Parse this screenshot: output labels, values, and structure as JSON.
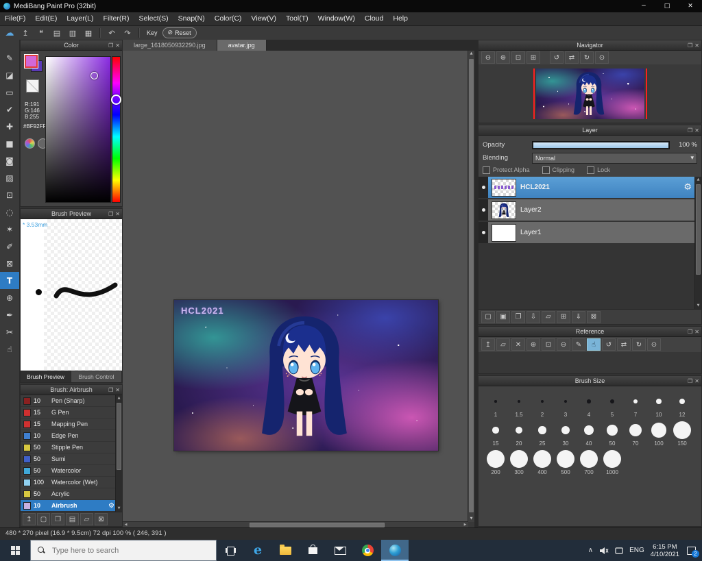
{
  "titlebar": {
    "title": "MediBang Paint Pro (32bit)"
  },
  "menubar": {
    "items": [
      "File(F)",
      "Edit(E)",
      "Layer(L)",
      "Filter(R)",
      "Select(S)",
      "Snap(N)",
      "Color(C)",
      "View(V)",
      "Tool(T)",
      "Window(W)",
      "Cloud",
      "Help"
    ]
  },
  "toolbar": {
    "key_label": "Key",
    "reset_label": "Reset"
  },
  "icons": {
    "minimize": "─",
    "maximize": "□",
    "close": "✕",
    "cloud": "☁",
    "upload": "↥",
    "comment": "❝",
    "grid1": "▤",
    "grid2": "▥",
    "grid3": "▦",
    "undo": "↶",
    "redo": "↷",
    "reset": "⊘",
    "popout": "❐",
    "panel_close": "✕",
    "zoom_out": "⊖",
    "zoom_in": "⊕",
    "zoom_fit": "⊡",
    "zoom_actual": "⊞",
    "rotate_ccw": "↺",
    "flip": "⇄",
    "rotate_cw": "↻",
    "rotate_reset": "⊙",
    "gear": "⚙",
    "dropdown": "▾",
    "up": "▲",
    "down": "▼",
    "left": "◀",
    "right": "▶",
    "add_layer": "▢",
    "add_pixel_layer": "▣",
    "duplicate": "❐",
    "transfer_down": "⇩",
    "folder": "▱",
    "apply": "⊞",
    "merge_down": "⇓",
    "trash": "⊠",
    "pen": "✎",
    "hand": "☝",
    "brush_upload": "↥",
    "brush_new": "▢",
    "brush_dup": "❐",
    "brush_edit": "▤",
    "brush_folder": "▱",
    "brush_trash": "⊠",
    "tray_up": "∧"
  },
  "tools": [
    {
      "name": "brush",
      "glyph": "✎"
    },
    {
      "name": "eraser",
      "glyph": "◪"
    },
    {
      "name": "shape",
      "glyph": "▭"
    },
    {
      "name": "snap",
      "glyph": "✔"
    },
    {
      "name": "move",
      "glyph": "✚"
    },
    {
      "name": "fill-rect",
      "glyph": "■"
    },
    {
      "name": "bucket",
      "glyph": "◙"
    },
    {
      "name": "gradient",
      "glyph": "▨"
    },
    {
      "name": "select",
      "glyph": "⊡"
    },
    {
      "name": "lasso",
      "glyph": "◌"
    },
    {
      "name": "magic-wand",
      "glyph": "✶"
    },
    {
      "name": "select-pen",
      "glyph": "✐"
    },
    {
      "name": "select-eraser",
      "glyph": "⊠"
    },
    {
      "name": "text",
      "glyph": "T",
      "selected": true
    },
    {
      "name": "zoom",
      "glyph": "⊕"
    },
    {
      "name": "eyedropper",
      "glyph": "✒"
    },
    {
      "name": "divide",
      "glyph": "✂"
    },
    {
      "name": "hand",
      "glyph": "☝"
    }
  ],
  "color_panel": {
    "title": "Color",
    "r": "R:191",
    "g": "G:146",
    "b": "B:255",
    "hex": "#BF92FF",
    "fg_color": "#BF92FF"
  },
  "brush_preview": {
    "title": "Brush Preview",
    "size_label": "* 3.53mm",
    "tab_preview": "Brush Preview",
    "tab_control": "Brush Control"
  },
  "brush_panel": {
    "title": "Brush: Airbrush",
    "items": [
      {
        "size": "10",
        "name": "Pen (Sharp)",
        "color": "#8a2020"
      },
      {
        "size": "15",
        "name": "G Pen",
        "color": "#d03030"
      },
      {
        "size": "15",
        "name": "Mapping Pen",
        "color": "#d03030"
      },
      {
        "size": "10",
        "name": "Edge Pen",
        "color": "#3f7fd0"
      },
      {
        "size": "50",
        "name": "Stipple Pen",
        "color": "#d8c840"
      },
      {
        "size": "50",
        "name": "Sumi",
        "color": "#4060c8"
      },
      {
        "size": "50",
        "name": "Watercolor",
        "color": "#40a8d8"
      },
      {
        "size": "100",
        "name": "Watercolor (Wet)",
        "color": "#90d0f0"
      },
      {
        "size": "50",
        "name": "Acrylic",
        "color": "#d8c840"
      },
      {
        "size": "10",
        "name": "Airbrush",
        "color": "#c8b0e0",
        "selected": true
      }
    ]
  },
  "document_tabs": [
    "large_1618050932290.jpg",
    "avatar.jpg"
  ],
  "canvas": {
    "watermark": "HCL2021"
  },
  "navigator": {
    "title": "Navigator"
  },
  "layer_panel": {
    "title": "Layer",
    "opacity_label": "Opacity",
    "opacity_value": "100 %",
    "blending_label": "Blending",
    "blending_value": "Normal",
    "protect_alpha": "Protect Alpha",
    "clipping": "Clipping",
    "lock": "Lock",
    "layers": [
      {
        "name": "HCL2021",
        "selected": true
      },
      {
        "name": "Layer2"
      },
      {
        "name": "Layer1"
      }
    ]
  },
  "reference": {
    "title": "Reference"
  },
  "brush_size": {
    "title": "Brush Size",
    "sizes": [
      "1",
      "1.5",
      "2",
      "3",
      "4",
      "5",
      "7",
      "10",
      "12",
      "15",
      "20",
      "25",
      "30",
      "40",
      "50",
      "70",
      "100",
      "150",
      "200",
      "300",
      "400",
      "500",
      "700",
      "1000"
    ]
  },
  "status_bar": {
    "text": "480 * 270 pixel   (16.9 * 9.5cm)   72 dpi   100 %    ( 246, 391 )"
  },
  "taskbar": {
    "search_placeholder": "Type here to search",
    "lang": "ENG",
    "time": "6:15 PM",
    "date": "4/10/2021",
    "badge": "2"
  },
  "colors": {
    "accent": "#3f83c0",
    "selection": "#2e7cc4",
    "slider_fill": "#9cc6e8",
    "navigator_guide": "#ff1f1f"
  }
}
